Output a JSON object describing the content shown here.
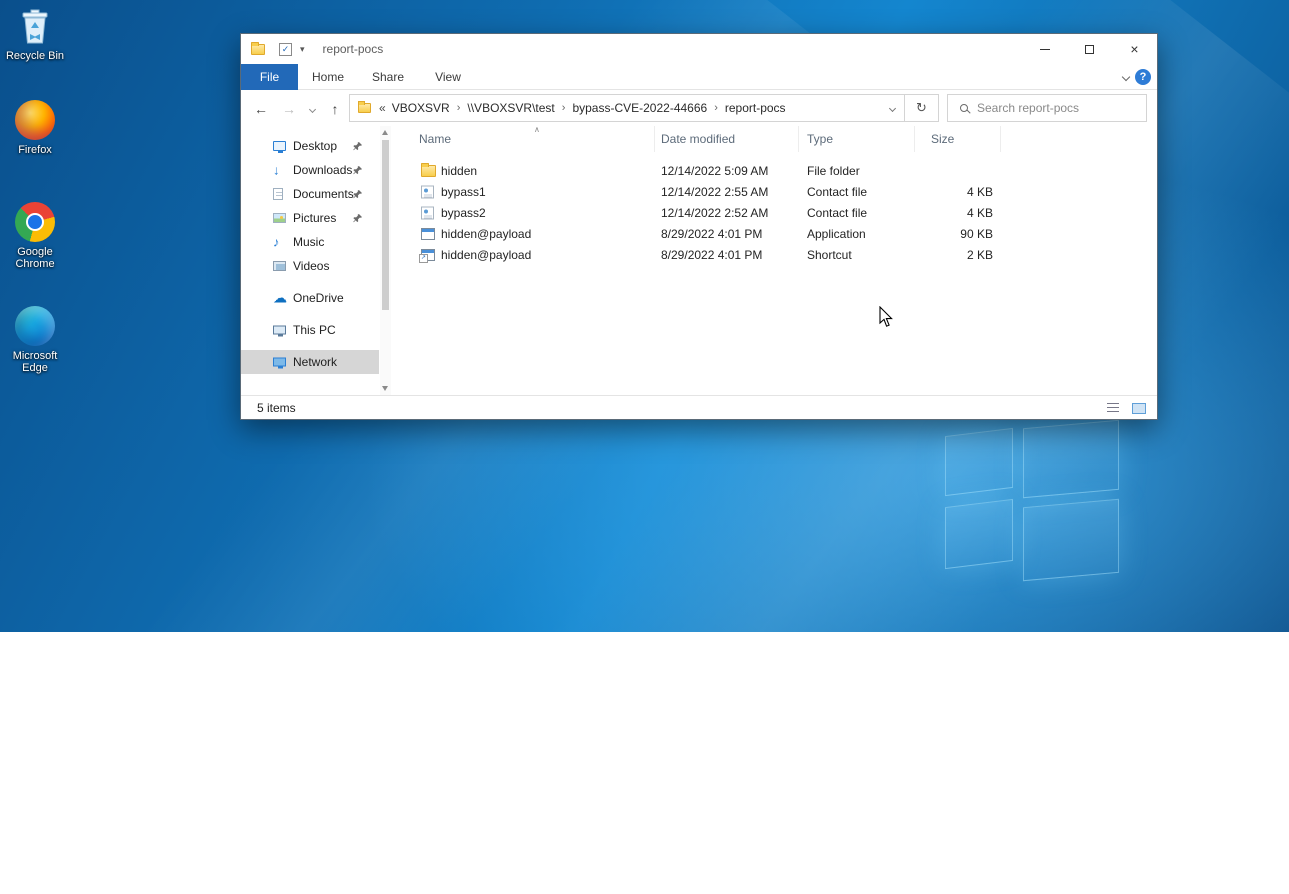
{
  "desktop": {
    "icons": [
      {
        "label": "Recycle Bin",
        "icon": "recycle-bin"
      },
      {
        "label": "Firefox",
        "icon": "firefox"
      },
      {
        "label": "Google Chrome",
        "icon": "chrome"
      },
      {
        "label": "Microsoft Edge",
        "icon": "edge"
      }
    ]
  },
  "window": {
    "title": "report-pocs",
    "controls": {
      "close": "×"
    },
    "icons": {
      "check": "✓",
      "toolbar_dropdown": "▾",
      "back": "←",
      "forward": "→",
      "up": "↑",
      "refresh": "↻",
      "breadcrumb_overflow": "«",
      "crumb_separator": "›",
      "help": "?",
      "sort_ascending": "∧"
    },
    "ribbon": {
      "tabs": [
        "File",
        "Home",
        "Share",
        "View"
      ]
    },
    "address": {
      "segments": [
        "VBOXSVR",
        "\\\\VBOXSVR\\test",
        "bypass-CVE-2022-44666",
        "report-pocs"
      ]
    },
    "search": {
      "placeholder": "Search report-pocs"
    },
    "nav_pane": {
      "items": [
        {
          "label": "Desktop",
          "icon": "desktop",
          "pinned": true,
          "gap": false,
          "selected": false
        },
        {
          "label": "Downloads",
          "icon": "downloads",
          "pinned": true,
          "gap": false,
          "selected": false
        },
        {
          "label": "Documents",
          "icon": "documents",
          "pinned": true,
          "gap": false,
          "selected": false
        },
        {
          "label": "Pictures",
          "icon": "pictures",
          "pinned": true,
          "gap": false,
          "selected": false
        },
        {
          "label": "Music",
          "icon": "music",
          "pinned": false,
          "gap": false,
          "selected": false
        },
        {
          "label": "Videos",
          "icon": "videos",
          "pinned": false,
          "gap": false,
          "selected": false
        },
        {
          "label": "OneDrive",
          "icon": "onedrive",
          "pinned": false,
          "gap": true,
          "selected": false
        },
        {
          "label": "This PC",
          "icon": "thispc",
          "pinned": false,
          "gap": true,
          "selected": false
        },
        {
          "label": "Network",
          "icon": "network",
          "pinned": false,
          "gap": true,
          "selected": true
        }
      ]
    },
    "columns": [
      "Name",
      "Date modified",
      "Type",
      "Size"
    ],
    "files": [
      {
        "name": "hidden",
        "date": "12/14/2022 5:09 AM",
        "type": "File folder",
        "size": "",
        "icon": "folder"
      },
      {
        "name": "bypass1",
        "date": "12/14/2022 2:55 AM",
        "type": "Contact file",
        "size": "4 KB",
        "icon": "contact"
      },
      {
        "name": "bypass2",
        "date": "12/14/2022 2:52 AM",
        "type": "Contact file",
        "size": "4 KB",
        "icon": "contact"
      },
      {
        "name": "hidden@payload",
        "date": "8/29/2022 4:01 PM",
        "type": "Application",
        "size": "90 KB",
        "icon": "application"
      },
      {
        "name": "hidden@payload",
        "date": "8/29/2022 4:01 PM",
        "type": "Shortcut",
        "size": "2 KB",
        "icon": "shortcut"
      }
    ],
    "status": {
      "items_count": "5 items"
    }
  },
  "colors": {
    "accent": "#2269b8",
    "selection": "#d6d6d6",
    "folder": "#f8ce4c"
  }
}
